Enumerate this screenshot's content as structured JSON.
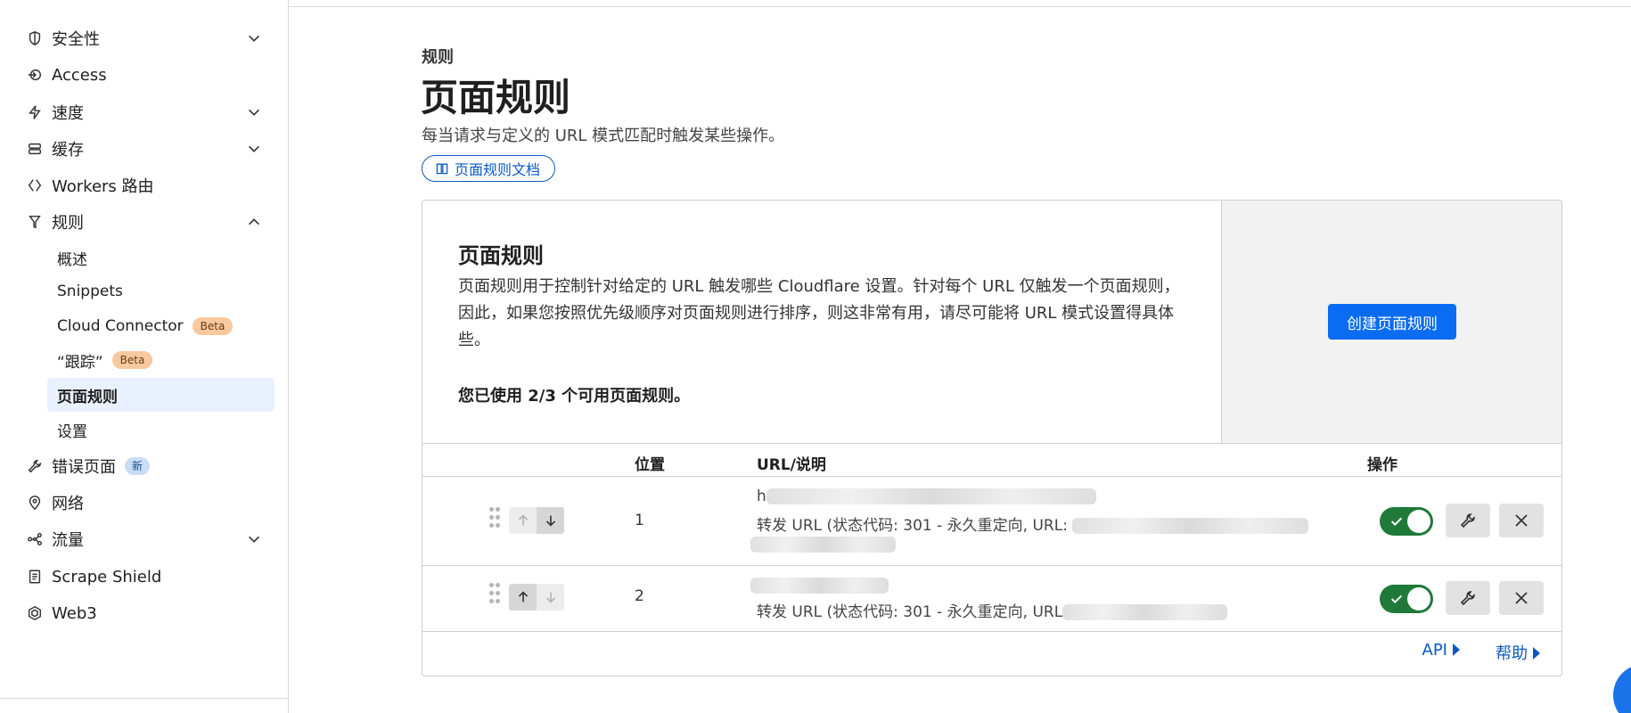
{
  "sidebar": {
    "items": [
      {
        "label": "安全性",
        "icon": "shield-icon",
        "chevron": "down"
      },
      {
        "label": "Access",
        "icon": "access-icon"
      },
      {
        "label": "速度",
        "icon": "bolt-icon",
        "chevron": "down"
      },
      {
        "label": "缓存",
        "icon": "storage-icon",
        "chevron": "down"
      },
      {
        "label": "Workers 路由",
        "icon": "workers-icon"
      },
      {
        "label": "规则",
        "icon": "funnel-icon",
        "chevron": "up"
      }
    ],
    "sub_items": [
      {
        "label": "概述"
      },
      {
        "label": "Snippets"
      },
      {
        "label": "Cloud Connector",
        "badge": "Beta"
      },
      {
        "label": "“跟踪”",
        "badge": "Beta"
      },
      {
        "label": "页面规则",
        "active": true
      },
      {
        "label": "设置"
      }
    ],
    "items_after": [
      {
        "label": "错误页面",
        "icon": "wrench-icon",
        "badge": "新"
      },
      {
        "label": "网络",
        "icon": "location-pin-icon"
      },
      {
        "label": "流量",
        "icon": "traffic-icon",
        "chevron": "down"
      },
      {
        "label": "Scrape Shield",
        "icon": "document-icon"
      },
      {
        "label": "Web3",
        "icon": "web3-icon"
      }
    ]
  },
  "header": {
    "breadcrumb": "规则",
    "title": "页面规则",
    "subtitle": "每当请求与定义的 URL 模式匹配时触发某些操作。",
    "doc_link": "页面规则文档"
  },
  "card": {
    "title": "页面规则",
    "description": "页面规则用于控制针对给定的 URL 触发哪些 Cloudflare 设置。针对每个 URL 仅触发一个页面规则，因此，如果您按照优先级顺序对页面规则进行排序，则这非常有用，请尽可能将 URL 模式设置得具体些。",
    "usage": "您已使用 2/3 个可用页面规则。",
    "create_button": "创建页面规则"
  },
  "table": {
    "columns": [
      "位置",
      "URL/说明",
      "操作"
    ],
    "rows": [
      {
        "position": "1",
        "url_prefix": "h",
        "action": "转发 URL (状态代码: 301 - 永久重定向, URL:",
        "enabled": true
      },
      {
        "position": "2",
        "url_prefix": "",
        "action": "转发 URL (状态代码: 301 - 永久重定向, URL",
        "enabled": true
      }
    ]
  },
  "footer": {
    "api_label": "API",
    "help_label": "帮助"
  },
  "colors": {
    "accent": "#0a6cf3",
    "link": "#0a58c2",
    "toggle_on": "#1f7a3a",
    "active_bg": "#e8f1fd"
  }
}
